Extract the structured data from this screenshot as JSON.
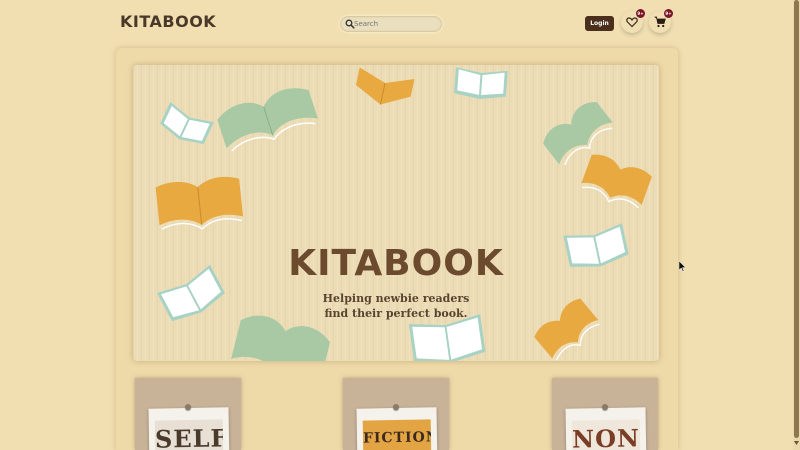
{
  "header": {
    "logo": "KITABOOK",
    "search": {
      "placeholder": "Search",
      "icon": "search-icon"
    },
    "login_label": "Login",
    "wishlist": {
      "icon": "heart-icon",
      "badge": "9+"
    },
    "cart": {
      "icon": "cart-icon",
      "badge": "9+"
    }
  },
  "hero": {
    "title": "KITABOOK",
    "subtitle_line1": "Helping newbie readers",
    "subtitle_line2": "find their perfect book."
  },
  "cards": [
    {
      "letters": "SELF",
      "letters_color": "#4a3a2c",
      "bg": "#e8e0d4"
    },
    {
      "letters": "FICTION",
      "letters_color": "#3c2a1f",
      "bg": "#e3a543"
    },
    {
      "letters": "NON",
      "letters_color": "#7a3d25",
      "bg": "#efe7db"
    }
  ],
  "colors": {
    "page_bg": "#f1dfb2",
    "brand_text": "#6b4a2e",
    "login_bg": "#4b2f1d",
    "badge": "#7a1526",
    "book_green": "#a8c9a4",
    "book_orange": "#e8a941"
  }
}
